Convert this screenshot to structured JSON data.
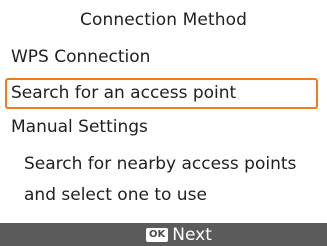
{
  "title": "Connection Method",
  "menu": {
    "items": [
      {
        "label": "WPS Connection",
        "selected": false
      },
      {
        "label": "Search for an access point",
        "selected": true
      },
      {
        "label": "Manual Settings",
        "selected": false
      }
    ]
  },
  "description": {
    "line1": "Search for nearby access points",
    "line2": "and select one to use"
  },
  "footer": {
    "ok_label": "OK",
    "next_label": "Next"
  },
  "colors": {
    "selection_border": "#f07d1b",
    "footer_background": "#5b5b5b"
  }
}
